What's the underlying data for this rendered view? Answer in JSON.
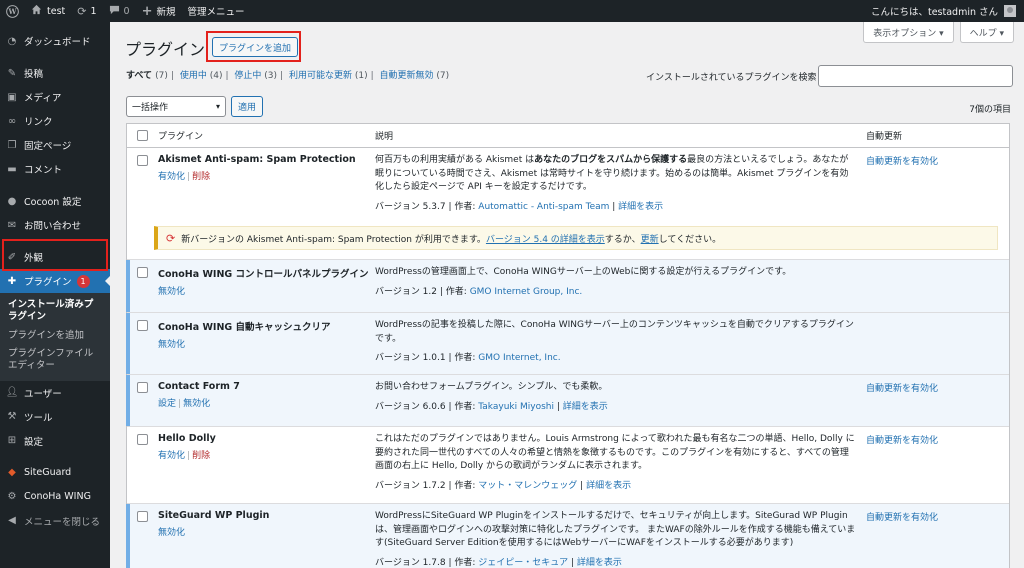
{
  "adminbar": {
    "site_name": "test",
    "updates_count": "1",
    "comments_count": "0",
    "new_label": "新規",
    "admin_menu_label": "管理メニュー",
    "greeting": "こんにちは、testadmin さん"
  },
  "sidebar": {
    "dashboard": "ダッシュボード",
    "posts": "投稿",
    "media": "メディア",
    "links": "リンク",
    "pages": "固定ページ",
    "comments": "コメント",
    "cocoon": "Cocoon 設定",
    "contact": "お問い合わせ",
    "appearance": "外観",
    "plugins": "プラグイン",
    "plugins_badge": "1",
    "sub_installed": "インストール済みプラグイン",
    "sub_add": "プラグインを追加",
    "sub_editor": "プラグインファイルエディター",
    "users": "ユーザー",
    "tools": "ツール",
    "settings": "設定",
    "siteguard": "SiteGuard",
    "conoha": "ConoHa WING",
    "collapse": "メニューを閉じる"
  },
  "screen_meta": {
    "options": "表示オプション ▾",
    "help": "ヘルプ ▾"
  },
  "page": {
    "title": "プラグイン",
    "add_button": "プラグインを追加",
    "filters": {
      "all": "すべて",
      "all_count": "(7)",
      "active": "使用中",
      "active_count": "(4)",
      "inactive": "停止中",
      "inactive_count": "(3)",
      "updates": "利用可能な更新",
      "updates_count": "(1)",
      "auto_disabled": "自動更新無効",
      "auto_disabled_count": "(7)"
    },
    "search_label": "インストールされているプラグインを検索",
    "search_value": "",
    "bulk_select": "一括操作",
    "apply": "適用",
    "items_count": "7個の項目"
  },
  "table": {
    "col_plugin": "プラグイン",
    "col_desc": "説明",
    "col_auto": "自動更新",
    "rows": [
      {
        "name": "Akismet Anti-spam: Spam Protection",
        "action1": "有効化",
        "action2": "削除",
        "desc_pre": "何百万もの利用実績がある Akismet は",
        "desc_bold": "あなたのブログをスパムから保護する",
        "desc_post": "最良の方法といえるでしょう。あなたが眠りについている時間でさえ、Akismet は常時サイトを守り続けます。始めるのは簡単。Akismet プラグインを有効化したら設定ページで API キーを設定するだけです。",
        "version": "バージョン 5.3.7",
        "author_label": "作者:",
        "author": "Automattic - Anti-spam Team",
        "details": "詳細を表示",
        "auto": "自動更新を有効化"
      },
      {
        "name": "ConoHa WING コントロールパネルプラグイン",
        "action1": "無効化",
        "desc": "WordPressの管理画面上で、ConoHa WINGサーバー上のWebに関する設定が行えるプラグインです。",
        "version": "バージョン 1.2",
        "author_label": "作者:",
        "author": "GMO Internet Group, Inc.",
        "auto": ""
      },
      {
        "name": "ConoHa WING 自動キャッシュクリア",
        "action1": "無効化",
        "desc": "WordPressの記事を投稿した際に、ConoHa WINGサーバー上のコンテンツキャッシュを自動でクリアするプラグインです。",
        "version": "バージョン 1.0.1",
        "author_label": "作者:",
        "author": "GMO Internet, Inc.",
        "auto": ""
      },
      {
        "name": "Contact Form 7",
        "action1": "設定",
        "action2": "無効化",
        "desc": "お問い合わせフォームプラグイン。シンプル、でも柔軟。",
        "version": "バージョン 6.0.6",
        "author_label": "作者:",
        "author": "Takayuki Miyoshi",
        "details": "詳細を表示",
        "auto": "自動更新を有効化"
      },
      {
        "name": "Hello Dolly",
        "action1": "有効化",
        "action2": "削除",
        "desc": "これはただのプラグインではありません。Louis Armstrong によって歌われた最も有名な二つの単語、Hello, Dolly に要約された同一世代のすべての人々の希望と情熱を象徴するものです。このプラグインを有効にすると、すべての管理画面の右上に Hello, Dolly からの歌詞がランダムに表示されます。",
        "version": "バージョン 1.7.2",
        "author_label": "作者:",
        "author": "マット・マレンウェッグ",
        "details": "詳細を表示",
        "auto": "自動更新を有効化"
      },
      {
        "name": "SiteGuard WP Plugin",
        "action1": "無効化",
        "desc": "WordPressにSiteGuard WP Pluginをインストールするだけで、セキュリティが向上します。SiteGurad WP Pluginは、管理画面やログインへの攻撃対策に特化したプラグインです。 またWAFの除外ルールを作成する機能も備えています(SiteGuard Server Editionを使用するにはWebサーバーにWAFをインストールする必要があります)",
        "version": "バージョン 1.7.8",
        "author_label": "作者:",
        "author": "ジェイピー・セキュア",
        "details": "詳細を表示",
        "auto": "自動更新を有効化"
      }
    ],
    "update_notice": {
      "pre": "新バージョンの Akismet Anti-spam: Spam Protection が利用できます。",
      "link1": "バージョン 5.4 の詳細を表示",
      "mid": "するか、",
      "link2": "更新",
      "post": "してください。"
    }
  }
}
